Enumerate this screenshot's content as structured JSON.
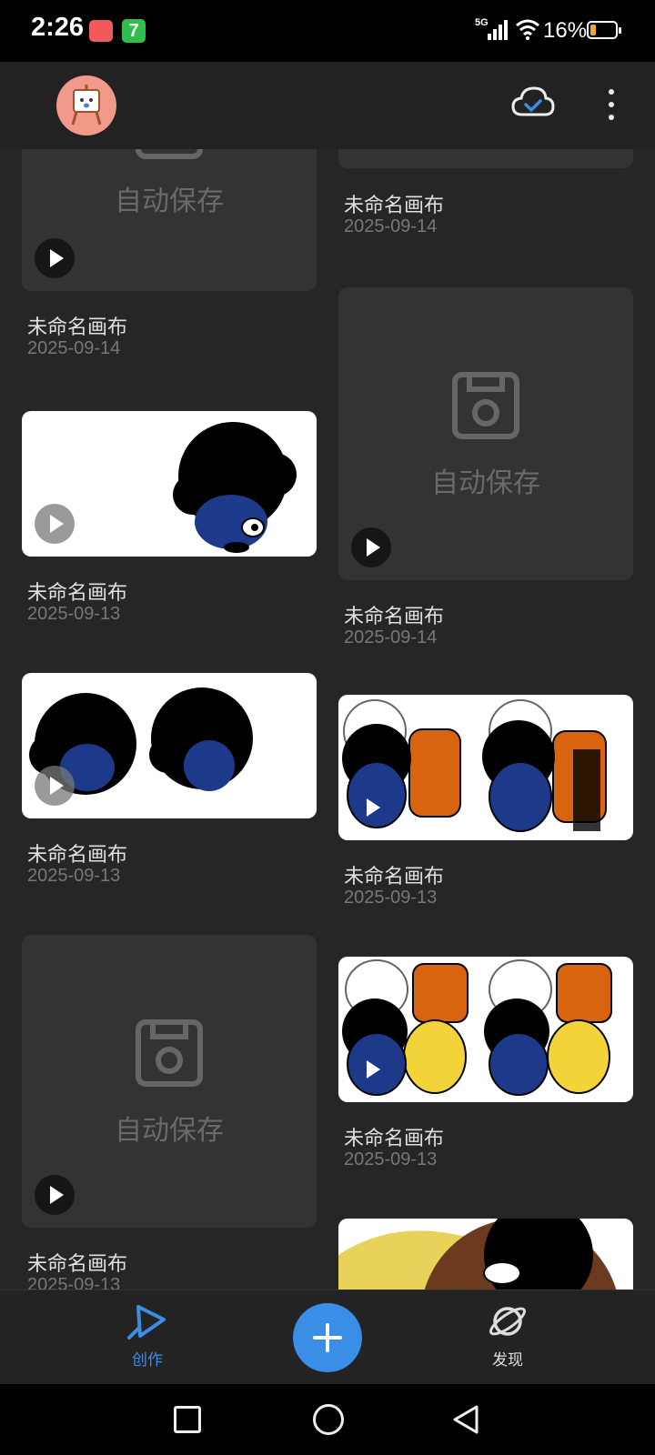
{
  "status_bar": {
    "time": "2:26",
    "notif_badge": "7",
    "network": "5G",
    "battery": "16%"
  },
  "header": {
    "avatar_icon": "painting-easel-avatar",
    "cloud_icon": "cloud-sync-check-icon",
    "more_icon": "more-vertical-icon"
  },
  "cards": [
    {
      "title": "未命名画布",
      "date": "2025-09-14",
      "thumb": "autosave",
      "autosave_label": "自动保存"
    },
    {
      "title": "未命名画布",
      "date": "2025-09-14",
      "thumb": "dark-partial"
    },
    {
      "title": "未命名画布",
      "date": "2025-09-13",
      "thumb": "drawing"
    },
    {
      "title": "未命名画布",
      "date": "2025-09-14",
      "thumb": "autosave",
      "autosave_label": "自动保存"
    },
    {
      "title": "未命名画布",
      "date": "2025-09-13",
      "thumb": "drawing"
    },
    {
      "title": "未命名画布",
      "date": "2025-09-13",
      "thumb": "drawing"
    },
    {
      "title": "未命名画布",
      "date": "2025-09-13",
      "thumb": "autosave",
      "autosave_label": "自动保存"
    },
    {
      "title": "未命名画布",
      "date": "2025-09-13",
      "thumb": "drawing"
    },
    {
      "title": "",
      "date": "",
      "thumb": "drawing-partial"
    }
  ],
  "bottom_nav": {
    "create_label": "创作",
    "discover_label": "发现",
    "accent": "#3a8ee6"
  }
}
